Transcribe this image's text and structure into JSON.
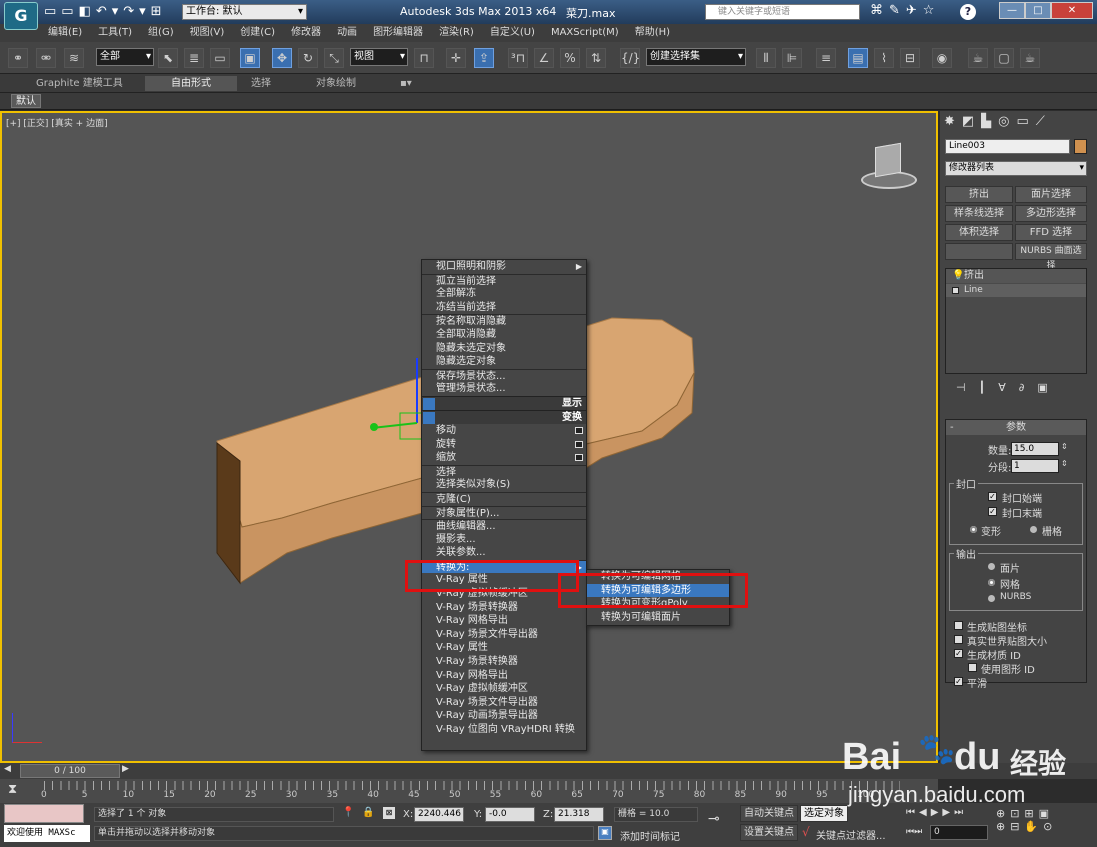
{
  "titlebar": {
    "workspace_label": "工作台: 默认",
    "app_title": "Autodesk 3ds Max  2013 x64",
    "file_name": "菜刀.max",
    "search_placeholder": "键入关键字或短语",
    "min": "—",
    "max": "□",
    "close": "✕"
  },
  "menubar": {
    "items": [
      "编辑(E)",
      "工具(T)",
      "组(G)",
      "视图(V)",
      "创建(C)",
      "修改器",
      "动画",
      "图形编辑器",
      "渲染(R)",
      "自定义(U)",
      "MAXScript(M)",
      "帮助(H)"
    ]
  },
  "toolbar": {
    "filter_value": "全部",
    "coord_value": "视图",
    "selset_value": "创建选择集"
  },
  "ribbon": {
    "tabs": [
      "Graphite 建模工具",
      "自由形式",
      "选择",
      "对象绘制"
    ],
    "subtab": "默认"
  },
  "viewport": {
    "label": "[+] [正交] [真实 + 边面]"
  },
  "context_menu": {
    "top_items": [
      "视口照明和阴影",
      "孤立当前选择",
      "全部解冻",
      "冻结当前选择",
      "按名称取消隐藏",
      "全部取消隐藏",
      "隐藏未选定对象",
      "隐藏选定对象",
      "保存场景状态...",
      "管理场景状态..."
    ],
    "header_display": "显示",
    "header_transform": "变换",
    "bottom_items": [
      "移动",
      "旋转",
      "缩放",
      "选择",
      "选择类似对象(S)",
      "克隆(C)",
      "对象属性(P)...",
      "曲线编辑器...",
      "摄影表...",
      "关联参数...",
      "转换为:",
      "V-Ray 属性",
      "V-Ray 虚拟帧缓冲区",
      "V-Ray 场景转换器",
      "V-Ray 网格导出",
      "V-Ray 场景文件导出器",
      "V-Ray 属性",
      "V-Ray 场景转换器",
      "V-Ray 网格导出",
      "V-Ray 虚拟帧缓冲区",
      "V-Ray 场景文件导出器",
      "V-Ray 动画场景导出器",
      "V-Ray 位图向 VRayHDRI 转换"
    ],
    "highlighted": "转换为:"
  },
  "submenu": {
    "items": [
      "转换为可编辑网格",
      "转换为可编辑多边形",
      "转换为可变形gPoly",
      "转换为可编辑面片"
    ],
    "highlighted": "转换为可编辑多边形"
  },
  "panel": {
    "object_name": "Line003",
    "modifier_list": "修改器列表",
    "buttons": [
      "挤出",
      "面片选择",
      "样条线选择",
      "多边形选择",
      "体积选择",
      "FFD 选择",
      "",
      "NURBS 曲面选择"
    ],
    "stack": [
      "挤出",
      "Line"
    ],
    "rollout_title": "参数",
    "amount_label": "数量:",
    "amount_value": "15.0",
    "segments_label": "分段:",
    "segments_value": "1",
    "capping_title": "封口",
    "cap_start": "封口始端",
    "cap_end": "封口末端",
    "morph": "变形",
    "grid": "栅格",
    "output_title": "输出",
    "out_patch": "面片",
    "out_mesh": "网格",
    "out_nurbs": "NURBS",
    "gen_map": "生成贴图坐标",
    "real_world": "真实世界贴图大小",
    "gen_matid": "生成材质 ID",
    "use_shape_id": "使用图形 ID",
    "smooth": "平滑"
  },
  "timeline": {
    "frame": "0 / 100",
    "ticks": [
      "0",
      "5",
      "10",
      "15",
      "20",
      "25",
      "30",
      "35",
      "40",
      "45",
      "50",
      "55",
      "60",
      "65",
      "70",
      "75",
      "80",
      "85",
      "90",
      "95",
      "100"
    ]
  },
  "status": {
    "selected": "选择了 1 个 对象",
    "prompt": "单击并拖动以选择并移动对象",
    "welcome": "欢迎使用 MAXSc",
    "x_label": "X:",
    "x_value": "2240.446",
    "y_label": "Y:",
    "y_value": "-0.0",
    "z_label": "Z:",
    "z_value": "21.318",
    "grid": "栅格 = 10.0",
    "auto_key": "自动关键点",
    "selected_obj": "选定对象",
    "set_key": "设置关键点",
    "key_filter": "关键点过滤器...",
    "add_time_tag": "添加时间标记",
    "frame_value": "0"
  },
  "watermark": {
    "brand": "Bai",
    "brand2": "du",
    "cn": "经验",
    "url": "jingyan.baidu.com"
  },
  "colors": {
    "highlight": "#3a78c0",
    "red_box": "#e01010",
    "object": "#c99461",
    "viewport_border": "#f0c000"
  }
}
